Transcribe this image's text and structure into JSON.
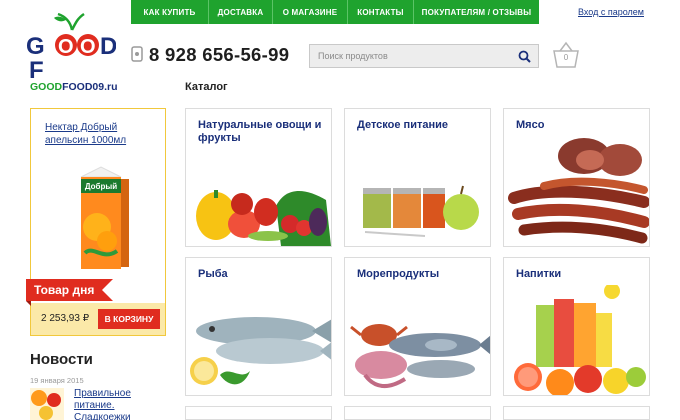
{
  "nav": {
    "items": [
      "Как купить",
      "Доставка",
      "О магазине",
      "Контакты",
      "Покупателям / отзывы"
    ]
  },
  "login": {
    "label": "Вход  с паролем"
  },
  "logo": {
    "letters": [
      "G",
      "O",
      "O",
      "D",
      "F"
    ],
    "site_prefix": "GOOD",
    "site_rest": "FOOD09.ru"
  },
  "header": {
    "phone": "8 928 656-56-99",
    "search_placeholder": "Поиск продуктов",
    "cart_count": "0"
  },
  "product_of_day": {
    "title": "Нектар Добрый апельсин 1000мл",
    "brand": "Добрый",
    "ribbon": "Товар дня",
    "price": "2 253,93 ₽",
    "buy_label": "В корзину"
  },
  "news": {
    "heading": "Новости",
    "date": "19 января 2015",
    "item_title": "Правильное питание. Сладкоежки"
  },
  "catalog": {
    "label": "Каталог",
    "categories": [
      "Натуральные овощи и фрукты",
      "Детское питание",
      "Мясо",
      "Рыба",
      "Морепродукты",
      "Напитки"
    ]
  },
  "colors": {
    "brand_green": "#1fa32e",
    "brand_blue": "#1a2f7a",
    "accent_red": "#e02c1f",
    "price_bg": "#fbe9a8",
    "promo_border": "#f1c83c"
  }
}
